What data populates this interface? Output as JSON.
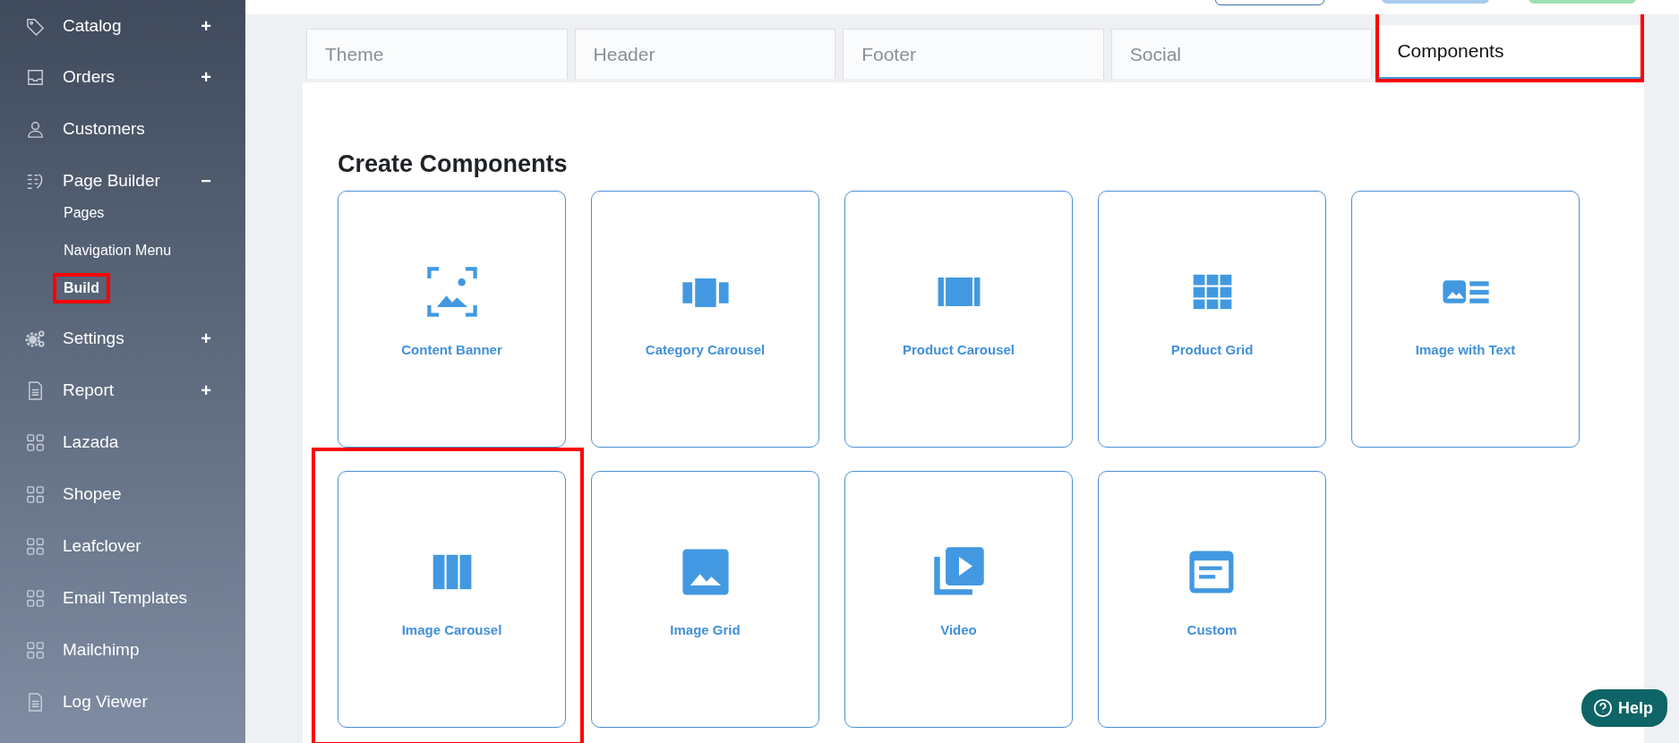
{
  "sidebar": {
    "items": [
      {
        "label": "Catalog",
        "kind": "tag",
        "toggle": "+"
      },
      {
        "label": "Orders",
        "kind": "inbox",
        "toggle": "+"
      },
      {
        "label": "Customers",
        "kind": "user"
      },
      {
        "label": "Page Builder",
        "kind": "builder",
        "toggle": "−",
        "children": [
          {
            "label": "Pages",
            "selected": false,
            "highlighted": false
          },
          {
            "label": "Navigation Menu",
            "selected": false,
            "highlighted": false
          },
          {
            "label": "Build",
            "selected": true,
            "highlighted": true
          }
        ]
      },
      {
        "label": "Settings",
        "kind": "gears",
        "toggle": "+"
      },
      {
        "label": "Report",
        "kind": "document",
        "toggle": "+"
      },
      {
        "label": "Lazada",
        "kind": "grid"
      },
      {
        "label": "Shopee",
        "kind": "grid"
      },
      {
        "label": "Leafclover",
        "kind": "grid"
      },
      {
        "label": "Email Templates",
        "kind": "grid"
      },
      {
        "label": "Mailchimp",
        "kind": "grid"
      },
      {
        "label": "Log Viewer",
        "kind": "document"
      }
    ]
  },
  "tabs": [
    {
      "label": "Theme",
      "selected": false,
      "highlighted": false
    },
    {
      "label": "Header",
      "selected": false,
      "highlighted": false
    },
    {
      "label": "Footer",
      "selected": false,
      "highlighted": false
    },
    {
      "label": "Social",
      "selected": false,
      "highlighted": false
    },
    {
      "label": "Components",
      "selected": true,
      "highlighted": true
    }
  ],
  "section": {
    "title": "Create Components",
    "components": [
      {
        "label": "Content Banner",
        "kind": "banner",
        "highlighted": false
      },
      {
        "label": "Category Carousel",
        "kind": "category-carousel",
        "highlighted": false
      },
      {
        "label": "Product Carousel",
        "kind": "product-carousel",
        "highlighted": false
      },
      {
        "label": "Product Grid",
        "kind": "grid",
        "highlighted": false
      },
      {
        "label": "Image with Text",
        "kind": "image-text",
        "highlighted": false
      },
      {
        "label": "Image Carousel",
        "kind": "columns",
        "highlighted": true
      },
      {
        "label": "Image Grid",
        "kind": "image",
        "highlighted": false
      },
      {
        "label": "Video",
        "kind": "video",
        "highlighted": false
      },
      {
        "label": "Custom",
        "kind": "custom",
        "highlighted": false
      }
    ]
  },
  "help_button": {
    "label": "Help"
  }
}
